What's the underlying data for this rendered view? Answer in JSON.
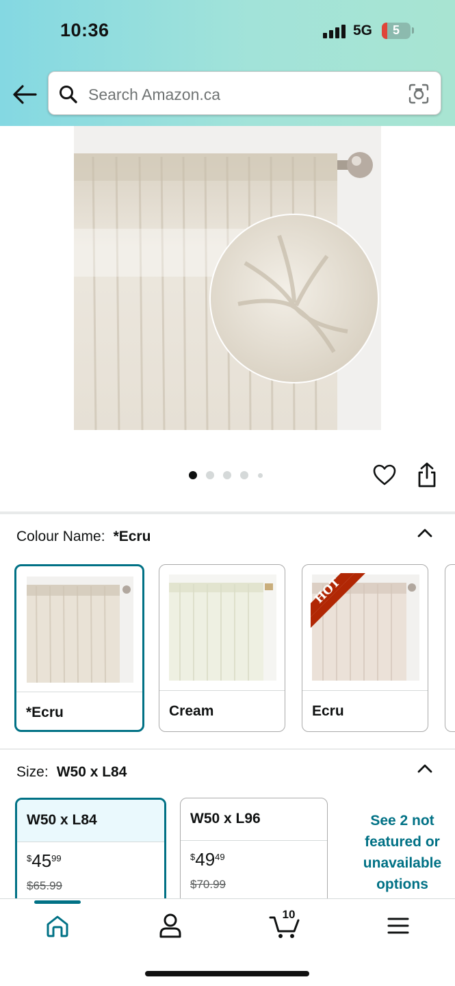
{
  "status_bar": {
    "time": "10:36",
    "network": "5G",
    "battery": "5"
  },
  "search": {
    "placeholder": "Search Amazon.ca"
  },
  "icons": {
    "back": "arrow-left-icon",
    "search": "search-icon",
    "camera": "camera-lens-icon",
    "wishlist": "heart-icon",
    "share": "share-icon",
    "collapse": "chevron-up-icon",
    "home": "home-icon",
    "account": "person-icon",
    "cart": "cart-icon",
    "menu": "hamburger-menu-icon"
  },
  "gallery": {
    "image_count": 5,
    "active_index": 0
  },
  "colour": {
    "label": "Colour Name:",
    "selected": "*Ecru",
    "options": [
      {
        "name": "*Ecru"
      },
      {
        "name": "Cream"
      },
      {
        "name": "Ecru",
        "badge": "HOT"
      }
    ]
  },
  "size": {
    "label": "Size:",
    "selected": "W50 x L84",
    "options": [
      {
        "name": "W50 x L84",
        "price_whole": "45",
        "price_fraction": "99",
        "currency": "$",
        "was": "$65.99"
      },
      {
        "name": "W50 x L96",
        "price_whole": "49",
        "price_fraction": "49",
        "currency": "$",
        "was": "$70.99"
      }
    ],
    "more_link": "See 2 not featured or unavailable options"
  },
  "bottom_nav": {
    "cart_count": "10",
    "active": "home"
  },
  "colors": {
    "accent": "#007185",
    "header_start": "#84d8e2",
    "header_end": "#a8e4d2",
    "hot_badge": "#b12704"
  }
}
